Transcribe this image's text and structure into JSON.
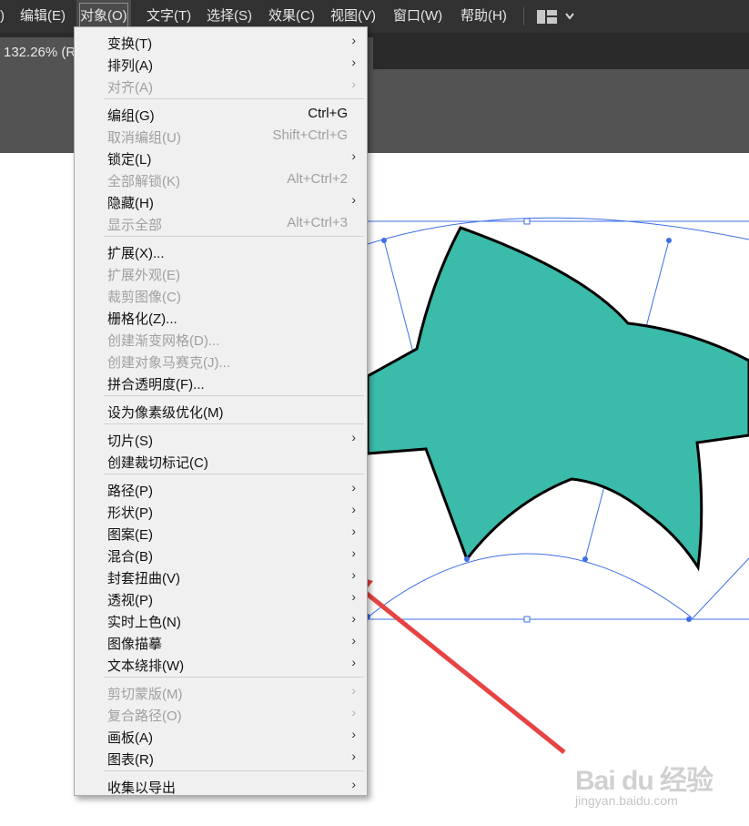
{
  "menubar": {
    "items": [
      {
        "label": ")"
      },
      {
        "label": "编辑(E)"
      },
      {
        "label": "对象(O)"
      },
      {
        "label": "文字(T)"
      },
      {
        "label": "选择(S)"
      },
      {
        "label": "效果(C)"
      },
      {
        "label": "视图(V)"
      },
      {
        "label": "窗口(W)"
      },
      {
        "label": "帮助(H)"
      }
    ],
    "active_index": 2
  },
  "document_tab": {
    "label": "132.26% (R"
  },
  "object_menu": {
    "items": [
      {
        "label": "变换(T)",
        "shortcut": "",
        "submenu": true,
        "enabled": true
      },
      {
        "label": "排列(A)",
        "shortcut": "",
        "submenu": true,
        "enabled": true
      },
      {
        "label": "对齐(A)",
        "shortcut": "",
        "submenu": true,
        "enabled": false
      },
      {
        "label": "编组(G)",
        "shortcut": "Ctrl+G",
        "submenu": false,
        "enabled": true
      },
      {
        "label": "取消编组(U)",
        "shortcut": "Shift+Ctrl+G",
        "submenu": false,
        "enabled": false
      },
      {
        "label": "锁定(L)",
        "shortcut": "",
        "submenu": true,
        "enabled": true
      },
      {
        "label": "全部解锁(K)",
        "shortcut": "Alt+Ctrl+2",
        "submenu": false,
        "enabled": false
      },
      {
        "label": "隐藏(H)",
        "shortcut": "",
        "submenu": true,
        "enabled": true
      },
      {
        "label": "显示全部",
        "shortcut": "Alt+Ctrl+3",
        "submenu": false,
        "enabled": false
      },
      {
        "label": "扩展(X)...",
        "shortcut": "",
        "submenu": false,
        "enabled": true
      },
      {
        "label": "扩展外观(E)",
        "shortcut": "",
        "submenu": false,
        "enabled": false
      },
      {
        "label": "裁剪图像(C)",
        "shortcut": "",
        "submenu": false,
        "enabled": false
      },
      {
        "label": "栅格化(Z)...",
        "shortcut": "",
        "submenu": false,
        "enabled": true
      },
      {
        "label": "创建渐变网格(D)...",
        "shortcut": "",
        "submenu": false,
        "enabled": false
      },
      {
        "label": "创建对象马赛克(J)...",
        "shortcut": "",
        "submenu": false,
        "enabled": false
      },
      {
        "label": "拼合透明度(F)...",
        "shortcut": "",
        "submenu": false,
        "enabled": true
      },
      {
        "label": "设为像素级优化(M)",
        "shortcut": "",
        "submenu": false,
        "enabled": true
      },
      {
        "label": "切片(S)",
        "shortcut": "",
        "submenu": true,
        "enabled": true
      },
      {
        "label": "创建裁切标记(C)",
        "shortcut": "",
        "submenu": false,
        "enabled": true
      },
      {
        "label": "路径(P)",
        "shortcut": "",
        "submenu": true,
        "enabled": true
      },
      {
        "label": "形状(P)",
        "shortcut": "",
        "submenu": true,
        "enabled": true
      },
      {
        "label": "图案(E)",
        "shortcut": "",
        "submenu": true,
        "enabled": true
      },
      {
        "label": "混合(B)",
        "shortcut": "",
        "submenu": true,
        "enabled": true
      },
      {
        "label": "封套扭曲(V)",
        "shortcut": "",
        "submenu": true,
        "enabled": true
      },
      {
        "label": "透视(P)",
        "shortcut": "",
        "submenu": true,
        "enabled": true
      },
      {
        "label": "实时上色(N)",
        "shortcut": "",
        "submenu": true,
        "enabled": true
      },
      {
        "label": "图像描摹",
        "shortcut": "",
        "submenu": true,
        "enabled": true
      },
      {
        "label": "文本绕排(W)",
        "shortcut": "",
        "submenu": true,
        "enabled": true
      },
      {
        "label": "剪切蒙版(M)",
        "shortcut": "",
        "submenu": true,
        "enabled": false
      },
      {
        "label": "复合路径(O)",
        "shortcut": "",
        "submenu": true,
        "enabled": false
      },
      {
        "label": "画板(A)",
        "shortcut": "",
        "submenu": true,
        "enabled": true
      },
      {
        "label": "图表(R)",
        "shortcut": "",
        "submenu": true,
        "enabled": true
      },
      {
        "label": "收集以导出",
        "shortcut": "",
        "submenu": true,
        "enabled": true
      }
    ],
    "submenu_glyph": "›"
  },
  "colors": {
    "menubar_bg": "#323232",
    "canvas_gray": "#535353",
    "menu_bg": "#f0f0f0",
    "shape_fill": "#3bbbaa",
    "selection_blue": "#3d6fe6",
    "arrow_red": "#e84343"
  },
  "icons": {
    "workspace": "workspace-layout-icon",
    "chevron": "chevron-down-icon",
    "annotation": "red-arrow-annotation"
  },
  "watermark": {
    "brand": "Bai du 经验",
    "url": "jingyan.baidu.com"
  }
}
